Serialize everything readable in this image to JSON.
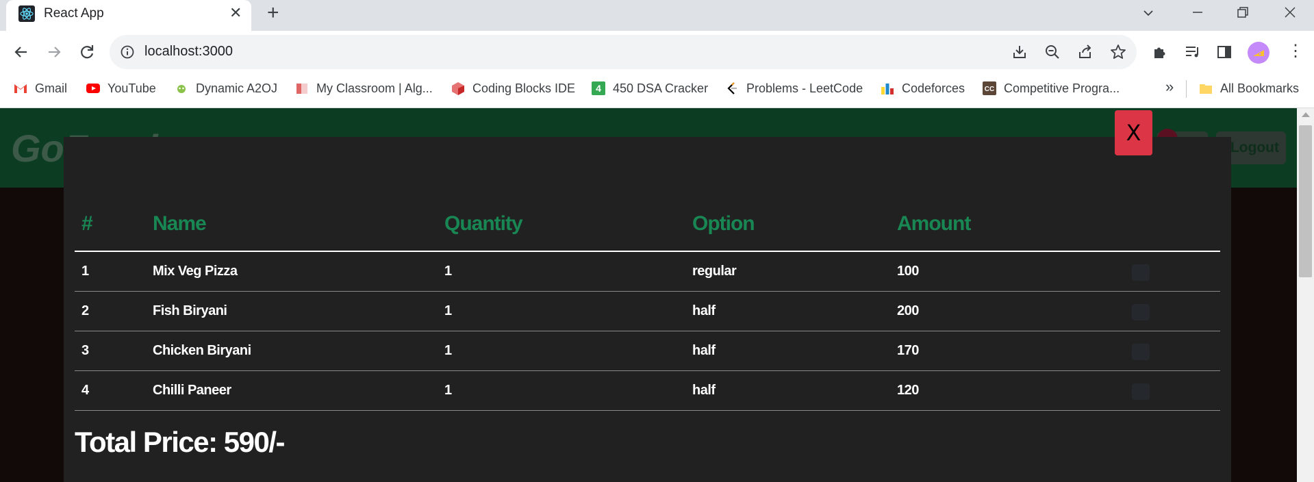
{
  "browser": {
    "tab_title": "React App",
    "url": "localhost:3000",
    "bookmarks": [
      {
        "label": "Gmail",
        "color": "#ea4335"
      },
      {
        "label": "YouTube",
        "color": "#ff0000"
      },
      {
        "label": "Dynamic A2OJ",
        "color": "#6aa84f"
      },
      {
        "label": "My Classroom | Alg...",
        "color": "#e06666"
      },
      {
        "label": "Coding Blocks IDE",
        "color": "#cc3333"
      },
      {
        "label": "450 DSA Cracker",
        "color": "#34a853"
      },
      {
        "label": "Problems - LeetCode",
        "color": "#f89f1b"
      },
      {
        "label": "Codeforces",
        "color": "#1f8acb"
      },
      {
        "label": "Competitive Progra...",
        "color": "#5b4638"
      }
    ],
    "more_bookmarks": "»",
    "all_bookmarks": "All Bookmarks"
  },
  "app": {
    "brand": "GoFood",
    "logout_label": "Logout"
  },
  "modal": {
    "close_label": "X",
    "table": {
      "headers": [
        "#",
        "Name",
        "Quantity",
        "Option",
        "Amount"
      ],
      "rows": [
        {
          "index": "1",
          "name": "Mix Veg Pizza",
          "qty": "1",
          "option": "regular",
          "amount": "100"
        },
        {
          "index": "2",
          "name": "Fish Biryani",
          "qty": "1",
          "option": "half",
          "amount": "200"
        },
        {
          "index": "3",
          "name": "Chicken Biryani",
          "qty": "1",
          "option": "half",
          "amount": "170"
        },
        {
          "index": "4",
          "name": "Chilli Paneer",
          "qty": "1",
          "option": "half",
          "amount": "120"
        }
      ]
    },
    "total_label": "Total Price: 590/-"
  },
  "colors": {
    "header_green": "#198754",
    "close_red": "#dc3545",
    "modal_bg": "#212121"
  }
}
